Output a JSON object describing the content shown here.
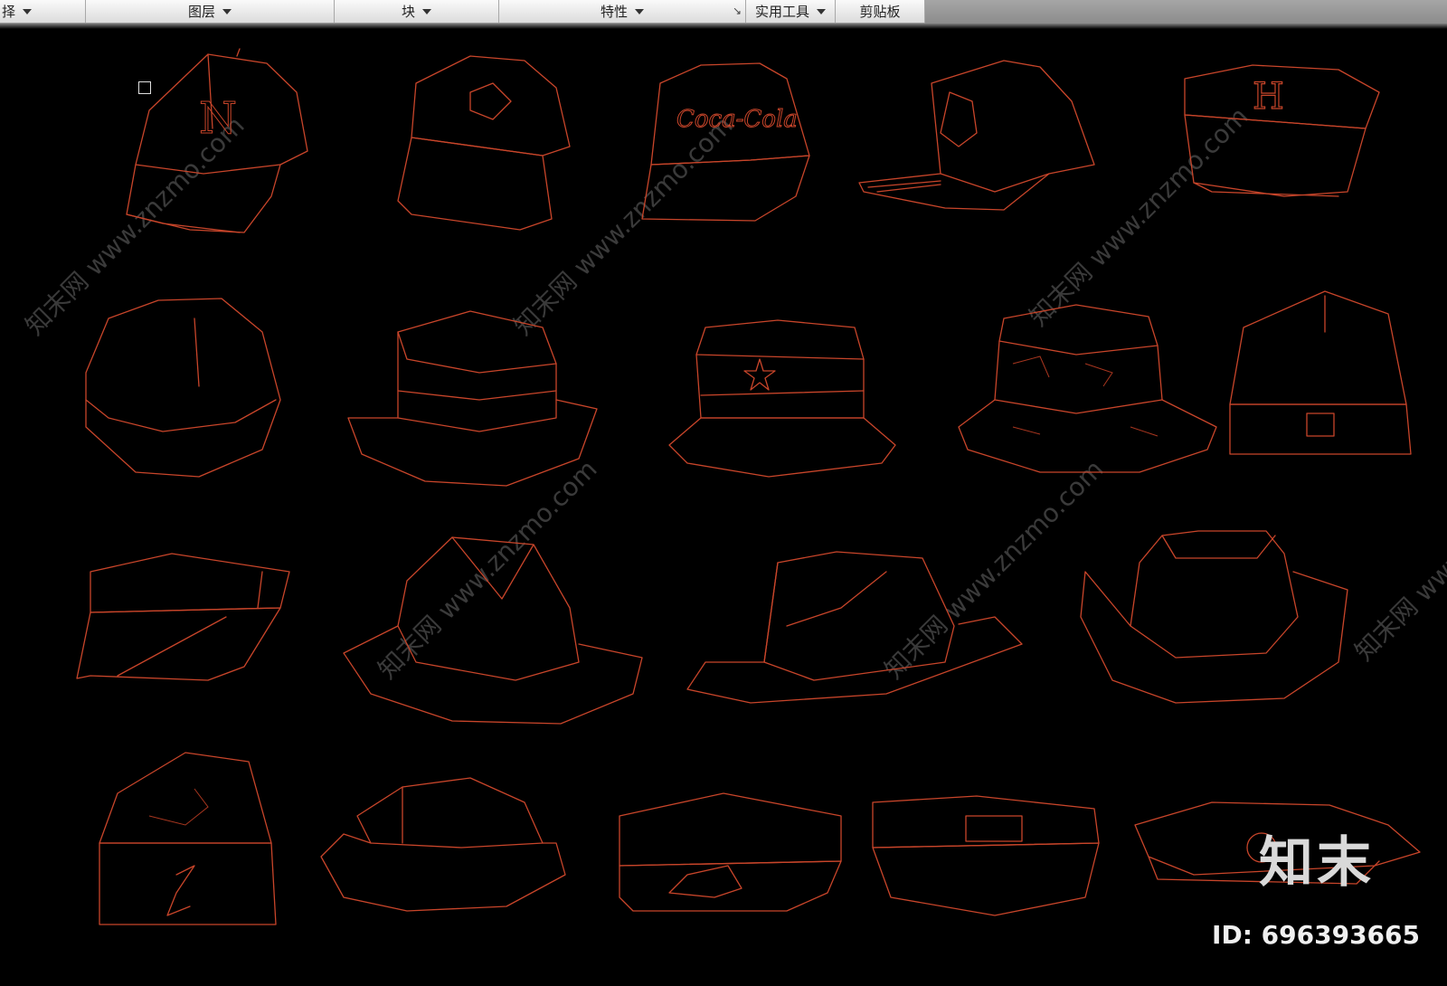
{
  "ribbon": {
    "panels": [
      {
        "label": "择",
        "width": 95
      },
      {
        "label": "图层",
        "width": 275
      },
      {
        "label": "块",
        "width": 182
      },
      {
        "label": "特性",
        "width": 273
      },
      {
        "label": "实用工具",
        "width": 99
      },
      {
        "label": "剪贴板",
        "width": 99
      }
    ],
    "launcher_icon": "dialog-launcher-icon"
  },
  "canvas": {
    "background": "#000000",
    "line_color": "#c8452a",
    "watermark": "知末网 www.znzmo.com",
    "hat_labels": {
      "cap1_letters": "N",
      "cap4_letter": "H",
      "cap3_script": "Coca-Cola"
    }
  },
  "branding": {
    "logo": "知末",
    "id": "ID: 696393665"
  }
}
